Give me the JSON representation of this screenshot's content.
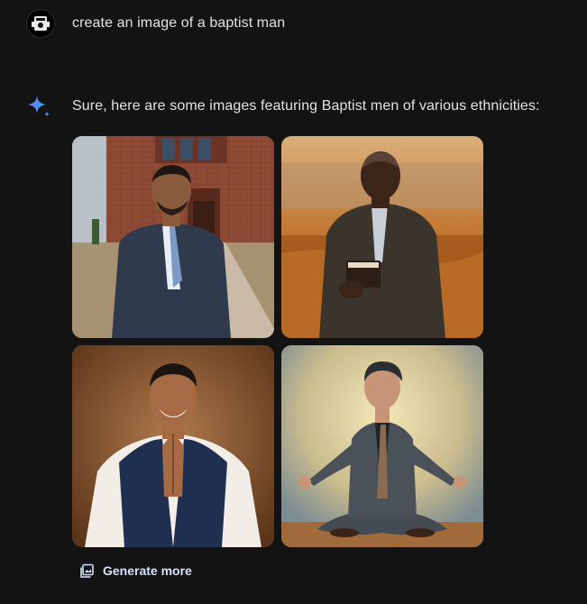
{
  "user": {
    "avatar_icon": "user-avatar-icon",
    "prompt": "create an image of a baptist man"
  },
  "response": {
    "assistant_icon": "gemini-sparkle-icon",
    "text": "Sure, here are some images featuring Baptist men of various ethnicities:",
    "images": [
      {
        "icon": "generated-image"
      },
      {
        "icon": "generated-image"
      },
      {
        "icon": "generated-image"
      },
      {
        "icon": "generated-image"
      }
    ],
    "generate_more_label": "Generate more",
    "generate_more_icon": "image-stack-icon"
  },
  "colors": {
    "background": "#131314",
    "text": "#e3e3e3",
    "link": "#d3e3fd",
    "accent_blue": "#4f8ef7"
  }
}
